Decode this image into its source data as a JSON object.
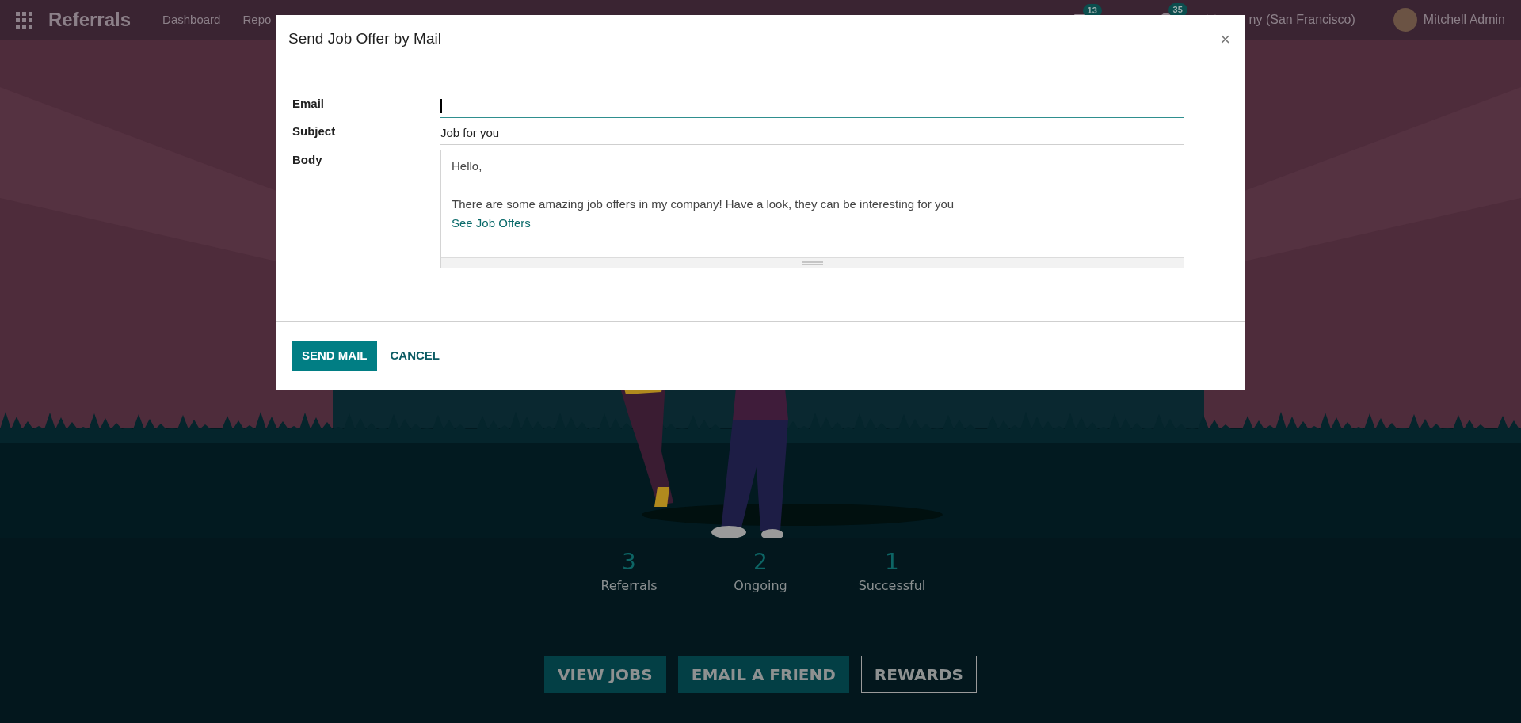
{
  "navbar": {
    "app_title": "Referrals",
    "menu": [
      {
        "label": "Dashboard"
      },
      {
        "label": "Repo"
      }
    ],
    "messages_badge": "13",
    "activities_badge": "35",
    "company": "ny (San Francisco)",
    "user": "Mitchell Admin"
  },
  "stats": [
    {
      "value": "3",
      "label": "Referrals"
    },
    {
      "value": "2",
      "label": "Ongoing"
    },
    {
      "value": "1",
      "label": "Successful"
    }
  ],
  "actions": [
    {
      "label": "VIEW JOBS",
      "kind": "filled"
    },
    {
      "label": "EMAIL A FRIEND",
      "kind": "filled"
    },
    {
      "label": "REWARDS",
      "kind": "outline"
    }
  ],
  "dialog": {
    "title": "Send Job Offer by Mail",
    "close": "×",
    "fields": [
      {
        "label": "Email",
        "focused": true
      },
      {
        "label": "Subject",
        "value": "Job for you",
        "focused": false
      }
    ],
    "body": {
      "label": "Body",
      "greeting": "Hello,",
      "message": "There are some amazing job offers in my company! Have a look, they can be interesting for you",
      "link": "See Job Offers"
    },
    "buttons": [
      {
        "label": "SEND MAIL",
        "kind": "primary"
      },
      {
        "label": "CANCEL",
        "kind": "link"
      }
    ]
  }
}
